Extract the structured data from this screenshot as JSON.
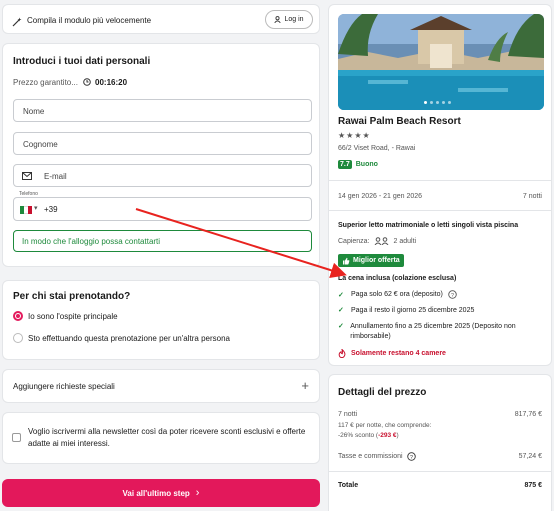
{
  "top_bar": {
    "text": "Compila il modulo più velocemente",
    "login_label": "Log in"
  },
  "personal": {
    "title": "Introduci i tuoi dati personali",
    "price_guarantee": "Prezzo garantito...",
    "timer": "00:16:20",
    "name_placeholder": "Nome",
    "surname_placeholder": "Cognome",
    "email_placeholder": "E-mail",
    "phone_label": "Telefono",
    "phone_prefix": "+39",
    "phone_hint": "In modo che l'alloggio possa contattarti"
  },
  "booking_for": {
    "title": "Per chi stai prenotando?",
    "option_main": "Io sono l'ospite principale",
    "option_other": "Sto effettuando questa prenotazione per un'altra persona"
  },
  "special_requests": {
    "label": "Aggiungere richieste speciali",
    "plus": "+"
  },
  "newsletter": {
    "text": "Voglio iscrivermi alla newsletter così da poter ricevere sconti esclusivi e offerte adatte ai miei interessi."
  },
  "cta": {
    "label": "Vai all'ultimo step",
    "arrow": "›"
  },
  "hotel": {
    "name": "Rawai Palm Beach Resort",
    "stars": "★★★★",
    "address": "66/2 Viset Road, - Rawai",
    "score": "7.7",
    "score_label": "Buono",
    "dates": "14 gen 2026 - 21 gen 2026",
    "nights": "7 notti",
    "room": "Superior letto matrimoniale o letti singoli vista piscina",
    "capacity_label": "Capienza:",
    "capacity_value": "2 adulti",
    "best_offer": "Miglior offerta",
    "meal": "La cena inclusa (colazione esclusa)",
    "pay_now": "Paga solo 62 € ora (deposito)",
    "pay_rest": "Paga il resto il giorno 25 dicembre 2025",
    "cancel": "Annullamento fino a 25 dicembre 2025 (Deposito non rimborsabile)",
    "scarcity": "Solamente restano 4 camere"
  },
  "price": {
    "title": "Dettagli del prezzo",
    "nights_label": "7 notti",
    "nights_value": "817,76 €",
    "per_night": "117 € per notte, che comprende:",
    "discount_prefix": "-26% sconto (",
    "discount_value": "-293 €",
    "discount_suffix": ")",
    "taxes_label": "Tasse e commissioni",
    "taxes_value": "57,24 €",
    "total_label": "Totale",
    "total_value": "875 €"
  }
}
